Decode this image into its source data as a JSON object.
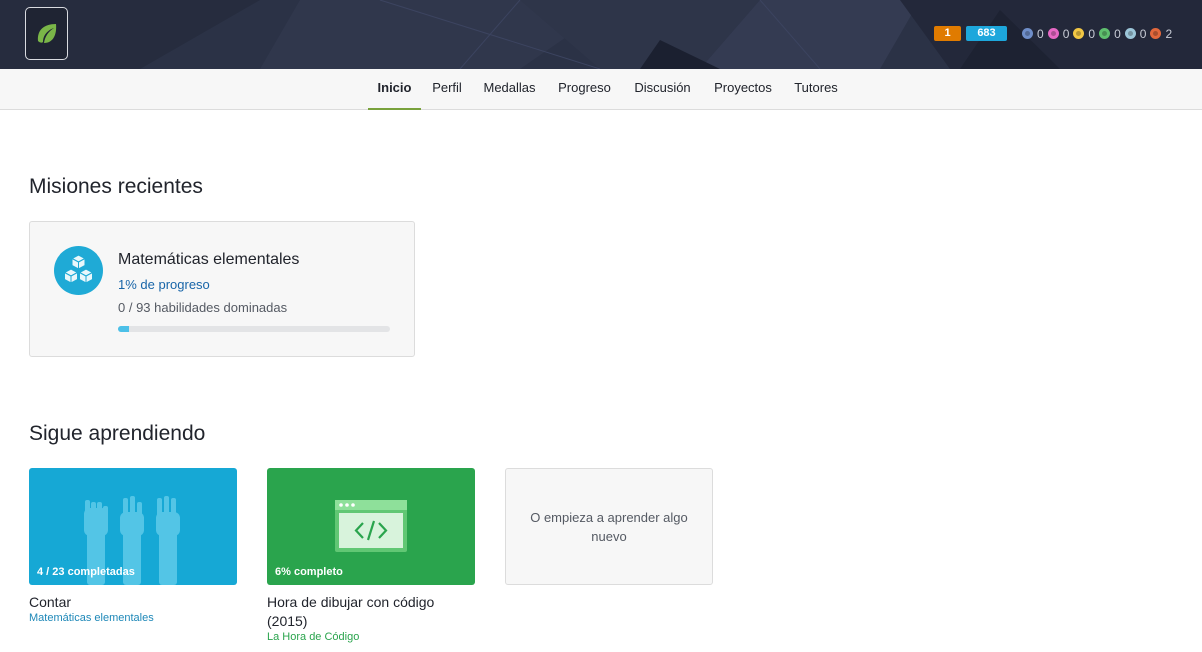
{
  "header": {
    "avatar_icon": "leaf-icon",
    "streak": "1",
    "points": "683",
    "badges": [
      {
        "icon": "meteorite-badge-icon",
        "count": "0",
        "color": "#6f8ec9"
      },
      {
        "icon": "moon-badge-icon",
        "count": "0",
        "color": "#e668c4"
      },
      {
        "icon": "earth-badge-icon",
        "count": "0",
        "color": "#f2c744"
      },
      {
        "icon": "sun-badge-icon",
        "count": "0",
        "color": "#5fbf6e"
      },
      {
        "icon": "black-hole-badge-icon",
        "count": "0",
        "color": "#9cc6d9"
      },
      {
        "icon": "challenge-patch-icon",
        "count": "2",
        "color": "#e2683c"
      }
    ]
  },
  "nav": {
    "tabs": [
      {
        "label": "Inicio",
        "active": true
      },
      {
        "label": "Perfil"
      },
      {
        "label": "Medallas"
      },
      {
        "label": "Progreso"
      },
      {
        "label": "Discusión"
      },
      {
        "label": "Proyectos"
      },
      {
        "label": "Tutores"
      }
    ]
  },
  "missions": {
    "title": "Misiones recientes",
    "card": {
      "icon": "cubes-icon",
      "title": "Matemáticas elementales",
      "progress_text": "1% de progreso",
      "skills_text": "0 / 93 habilidades dominadas",
      "progress_fraction": 0.04
    }
  },
  "learning": {
    "title": "Sigue aprendiendo",
    "courses": [
      {
        "overlay": "4 / 23 completadas",
        "title": "Contar",
        "subtitle": "Matemáticas elementales",
        "image_icon": "counting-hands-icon"
      },
      {
        "overlay": "6% completo",
        "title": "Hora de dibujar con código (2015)",
        "subtitle": "La Hora de Código",
        "image_icon": "code-window-icon"
      }
    ],
    "start_new": "O empieza a aprender algo nuevo"
  },
  "colors": {
    "accent_green": "#79a23c",
    "link_blue": "#1865a8",
    "subtitle_blue": "#1e88b8",
    "subtitle_green": "#2aa44d"
  }
}
